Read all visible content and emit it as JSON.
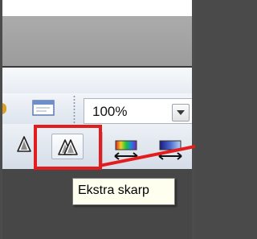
{
  "toolbar": {
    "zoom": {
      "value": "100%"
    },
    "buttons": [
      {
        "name": "sharpen",
        "icon": "sharpen-icon"
      },
      {
        "name": "extra-sharpen",
        "icon": "extra-sharpen-icon"
      },
      {
        "name": "color-adjust",
        "icon": "color-balance-icon"
      },
      {
        "name": "color-adjust-2",
        "icon": "color-adjust-icon"
      }
    ]
  },
  "tooltip": {
    "text": "Ekstra skarp"
  },
  "colors": {
    "highlight_annotation": "#e31d1d",
    "toolbar_gradient_top": "#f2f5f9",
    "toolbar_gradient_bottom": "#d6dde8",
    "tooltip_bg": "#fffff0"
  }
}
